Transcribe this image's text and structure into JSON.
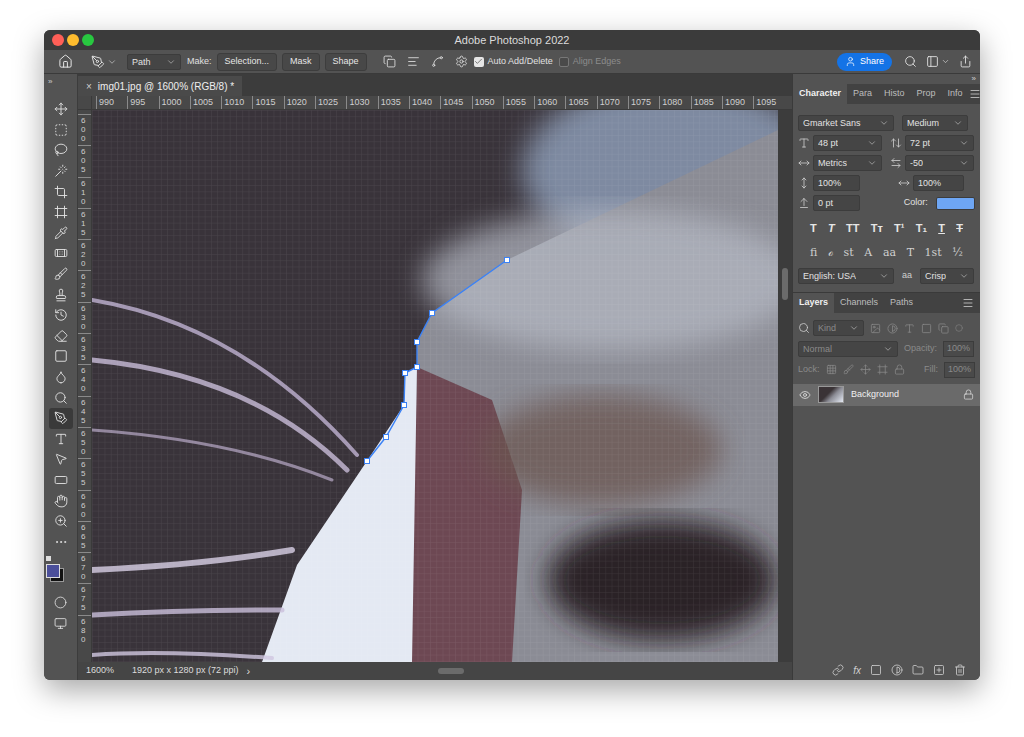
{
  "window": {
    "title": "Adobe Photoshop 2022"
  },
  "options_bar": {
    "tool_mode": "Path",
    "make_label": "Make:",
    "make_buttons": [
      "Selection...",
      "Mask",
      "Shape"
    ],
    "checkboxes": [
      {
        "label": "Auto Add/Delete",
        "checked": true,
        "disabled": false
      },
      {
        "label": "Align Edges",
        "checked": false,
        "disabled": true
      }
    ],
    "share": "Share"
  },
  "collapse_glyph": "»",
  "toolbar": {
    "tools": [
      {
        "kind": "move",
        "selected": false
      },
      {
        "kind": "marquee",
        "selected": false
      },
      {
        "kind": "lasso",
        "selected": false
      },
      {
        "kind": "wand",
        "selected": false
      },
      {
        "kind": "crop",
        "selected": false
      },
      {
        "kind": "frame",
        "selected": false
      },
      {
        "kind": "eyedropper",
        "selected": false
      },
      {
        "kind": "healing",
        "selected": false
      },
      {
        "kind": "brush",
        "selected": false
      },
      {
        "kind": "stamp",
        "selected": false
      },
      {
        "kind": "history",
        "selected": false
      },
      {
        "kind": "eraser",
        "selected": false
      },
      {
        "kind": "gradient",
        "selected": false
      },
      {
        "kind": "blur",
        "selected": false
      },
      {
        "kind": "dodge",
        "selected": false
      },
      {
        "kind": "pen",
        "selected": true
      },
      {
        "kind": "type",
        "selected": false
      },
      {
        "kind": "path-select",
        "selected": false
      },
      {
        "kind": "shape",
        "selected": false
      },
      {
        "kind": "hand",
        "selected": false
      },
      {
        "kind": "zoom",
        "selected": false
      },
      {
        "kind": "more",
        "selected": false
      }
    ],
    "foreground": "#4b4f9a",
    "background": "#111111"
  },
  "document_tab": {
    "close": "×",
    "title": "img01.jpg @ 1600% (RGB/8) *"
  },
  "ruler": {
    "horizontal": [
      "990",
      "995",
      "1000",
      "1005",
      "1010",
      "1015",
      "1020",
      "1025",
      "1030",
      "1035",
      "1040",
      "1045",
      "1050",
      "1055",
      "1060",
      "1065",
      "1070",
      "1075",
      "1080",
      "1085",
      "1090",
      "1095"
    ],
    "vertical": [
      "600",
      "605",
      "610",
      "615",
      "620",
      "625",
      "630",
      "635",
      "640",
      "645",
      "650",
      "655",
      "660",
      "665",
      "670",
      "675",
      "680"
    ]
  },
  "character_panel": {
    "tabs": [
      {
        "label": "Character",
        "selected": true
      },
      {
        "label": "Para",
        "selected": false
      },
      {
        "label": "Histo",
        "selected": false
      },
      {
        "label": "Prop",
        "selected": false
      },
      {
        "label": "Info",
        "selected": false
      }
    ],
    "font_family": "Gmarket Sans",
    "font_style": "Medium",
    "size": "48 pt",
    "leading": "72 pt",
    "kerning": "Metrics",
    "tracking": "-50",
    "vertical_scale": "100%",
    "horizontal_scale": "100%",
    "baseline_shift": "0 pt",
    "color_label": "Color:",
    "color": "#6ea6f4",
    "style_buttons": [
      {
        "label": "T",
        "kind": "bold"
      },
      {
        "label": "T",
        "kind": "italic"
      },
      {
        "label": "TT",
        "kind": "caps"
      },
      {
        "label": "Tт",
        "kind": "smallcaps"
      },
      {
        "label": "T¹",
        "kind": "super"
      },
      {
        "label": "T₁",
        "kind": "sub"
      },
      {
        "label": "T",
        "kind": "underline"
      },
      {
        "label": "T",
        "kind": "strike"
      }
    ],
    "opentype_buttons": [
      "ﬁ",
      "ℴ",
      "st",
      "A",
      "aa",
      "T",
      "1st",
      "½"
    ],
    "language": "English: USA",
    "aa_label": "aa",
    "antialias": "Crisp"
  },
  "layers_panel": {
    "tabs": [
      {
        "label": "Layers",
        "selected": true
      },
      {
        "label": "Channels",
        "selected": false
      },
      {
        "label": "Paths",
        "selected": false
      }
    ],
    "filter": "Kind",
    "blend_mode": "Normal",
    "opacity_label": "Opacity:",
    "opacity": "100%",
    "lock_label": "Lock:",
    "fill_label": "Fill:",
    "fill": "100%",
    "controls_disabled": true,
    "layers": [
      {
        "name": "Background",
        "visible": true,
        "locked": true,
        "selected": true
      }
    ],
    "fx_label": "fx"
  },
  "status_bar": {
    "zoom": "1600%",
    "doc_info": "1920 px x 1280 px (72 ppi)",
    "arrow": "›"
  }
}
